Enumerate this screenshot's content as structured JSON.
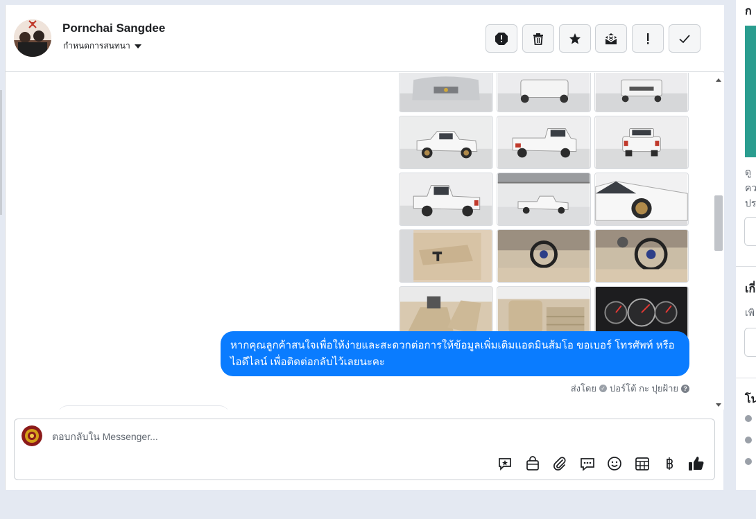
{
  "header": {
    "contact_name": "Pornchai Sangdee",
    "assign_label": "กำหนดการสนทนา"
  },
  "header_actions": [
    {
      "name": "report",
      "icon": "alert-octagon-icon"
    },
    {
      "name": "delete",
      "icon": "trash-icon"
    },
    {
      "name": "star",
      "icon": "star-icon"
    },
    {
      "name": "mark-unread",
      "icon": "envelope-open-icon"
    },
    {
      "name": "priority",
      "icon": "exclamation-icon"
    },
    {
      "name": "done",
      "icon": "checkmark-icon"
    }
  ],
  "messages": {
    "outgoing_text": "หากคุณลูกค้าสนใจเพื่อให้ง่ายและสะดวกต่อการให้ข้อมูลเพิ่มเติมแอดมินส้มโอ ขอเบอร์ โทรศัพท์ หรือ ไอดีไลน์ เพื่อติดต่อกลับไว้เลยนะคะ",
    "sent_by_label": "ส่งโดย",
    "sent_by_name": "ปอร์โต้ กะ ปุยฝ้าย"
  },
  "composer": {
    "placeholder": "ตอบกลับใน Messenger...",
    "tools": [
      "saved-replies-icon",
      "shop-bag-icon",
      "attachment-icon",
      "chat-bubble-icon",
      "emoji-icon",
      "appointment-icon",
      "baht-icon",
      "thumbs-up-icon"
    ]
  },
  "colors": {
    "bubble": "#0a7cff",
    "accent_teal": "#2a9d8f"
  }
}
